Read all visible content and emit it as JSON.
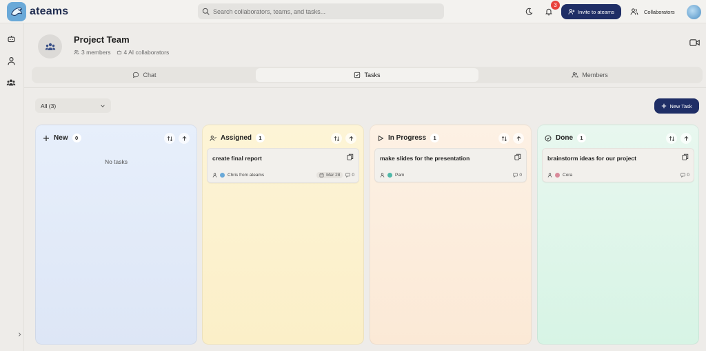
{
  "app": {
    "brand": "ateams"
  },
  "search": {
    "placeholder": "Search collaborators, teams, and tasks..."
  },
  "header": {
    "notifications_count": "3",
    "invite_label": "Invite to ateams",
    "collaborators_label": "Collaborators"
  },
  "team": {
    "title": "Project Team",
    "members": "3 members",
    "ai_collaborators": "4 AI collaborators"
  },
  "tabs": [
    {
      "label": "Chat",
      "icon": "chat-icon"
    },
    {
      "label": "Tasks",
      "icon": "tasks-icon",
      "active": true
    },
    {
      "label": "Members",
      "icon": "members-icon"
    }
  ],
  "filter": {
    "value": "All (3)"
  },
  "new_task_label": "New Task",
  "columns": {
    "new": {
      "title": "New",
      "count": "0",
      "empty_text": "No tasks"
    },
    "assigned": {
      "title": "Assigned",
      "count": "1",
      "card": {
        "title": "create final report",
        "assignee": "Chris from ateams",
        "date": "Mar 28",
        "comments": "0"
      }
    },
    "progress": {
      "title": "In Progress",
      "count": "1",
      "card": {
        "title": "make slides for the presentation",
        "assignee": "Pam",
        "comments": "0"
      }
    },
    "done": {
      "title": "Done",
      "count": "1",
      "card": {
        "title": "brainstorm ideas for our project",
        "assignee": "Cora",
        "comments": "0"
      }
    }
  },
  "colors": {
    "primary": "#1f2e66",
    "badge": "#e8413a",
    "col_new": "#e7effb",
    "col_assigned": "#fdf4d6",
    "col_progress": "#fdf1e4",
    "col_done": "#e8f7ef"
  }
}
